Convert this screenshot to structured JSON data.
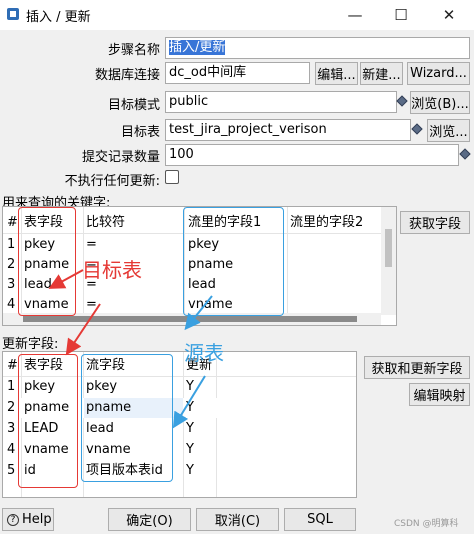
{
  "window": {
    "title": "插入 / 更新",
    "minimize_glyph": "—",
    "maximize_glyph": "☐",
    "close_glyph": "✕"
  },
  "form": {
    "step_name_label": "步骤名称",
    "step_name_value": "插入/更新",
    "connection_label": "数据库连接",
    "connection_value": "dc_od中间库",
    "edit_button": "编辑...",
    "new_button": "新建...",
    "wizard_button": "Wizard...",
    "schema_label": "目标模式",
    "schema_value": "public",
    "browse_b_button": "浏览(B)...",
    "target_table_label": "目标表",
    "target_table_value": "test_jira_project_verison",
    "browse_button": "浏览...",
    "commit_label": "提交记录数量",
    "commit_value": "100",
    "no_update_label": "不执行任何更新:"
  },
  "key_section": {
    "label": "用来查询的关键字:",
    "get_fields_button": "获取字段",
    "columns": [
      "#",
      "表字段",
      "比较符",
      "流里的字段1",
      "流里的字段2"
    ],
    "rows": [
      [
        "1",
        "pkey",
        "=",
        "pkey",
        ""
      ],
      [
        "2",
        "pname",
        "=",
        "pname",
        ""
      ],
      [
        "3",
        "lead",
        "=",
        "lead",
        ""
      ],
      [
        "4",
        "vname",
        "=",
        "vname",
        ""
      ]
    ]
  },
  "update_section": {
    "label": "更新字段:",
    "get_update_button": "获取和更新字段",
    "edit_mapping_button": "编辑映射",
    "columns": [
      "#",
      "表字段",
      "流字段",
      "更新"
    ],
    "rows": [
      [
        "1",
        "pkey",
        "pkey",
        "Y"
      ],
      [
        "2",
        "pname",
        "pname",
        "Y"
      ],
      [
        "3",
        "LEAD",
        "lead",
        "Y"
      ],
      [
        "4",
        "vname",
        "vname",
        "Y"
      ],
      [
        "5",
        "id",
        "项目版本表id",
        "Y"
      ]
    ]
  },
  "annotations": {
    "target_table": "目标表",
    "source_table": "源表",
    "red_color": "#e53935",
    "blue_color": "#3aa0e0"
  },
  "bottom": {
    "help_button": "Help",
    "ok_button": "确定(O)",
    "cancel_button": "取消(C)",
    "sql_button": "SQL",
    "watermark": "CSDN @明算科"
  }
}
